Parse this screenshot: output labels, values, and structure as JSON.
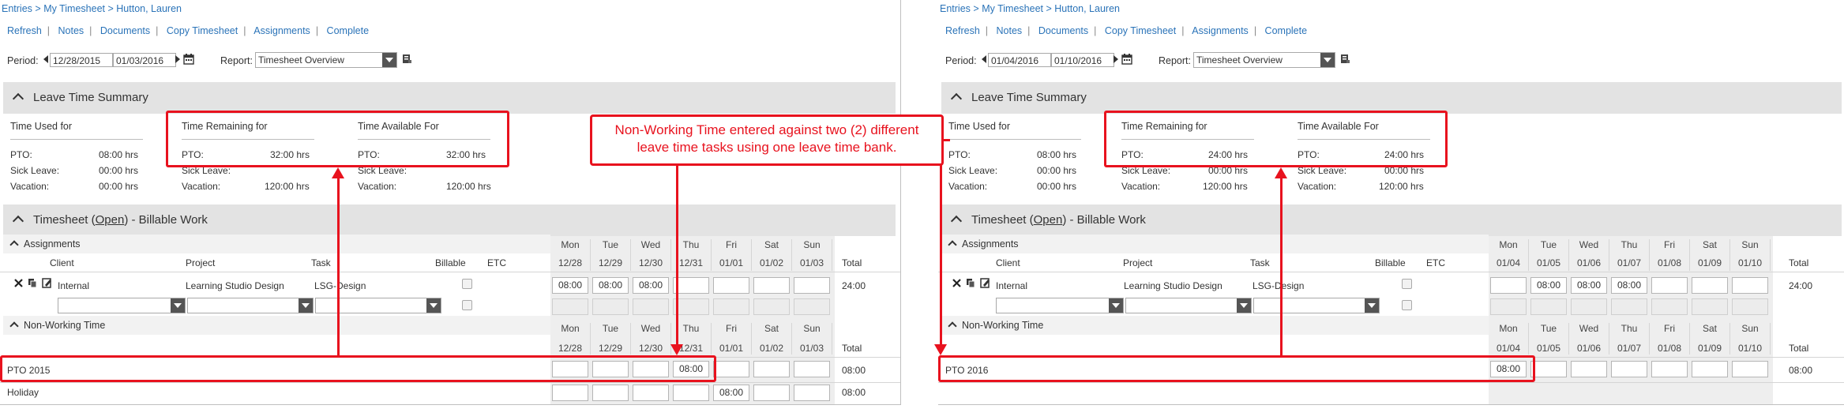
{
  "colors": {
    "link": "#2a73b8",
    "annotation_red": "#e8121e",
    "section_bg": "#e3e3e3"
  },
  "icons": [
    "prev-arrow-icon",
    "next-arrow-icon",
    "calendar-icon",
    "export-icon",
    "delete-icon",
    "copy-icon",
    "edit-icon",
    "collapse-caret-icon"
  ],
  "callout": {
    "line1": "Non-Working Time entered against two (2) different",
    "line2": "leave time tasks using one leave time bank."
  },
  "panels": {
    "left": {
      "breadcrumb": {
        "entries": "Entries",
        "sep1": ">",
        "my_timesheet": "My Timesheet",
        "sep2": ">",
        "user": "Hutton, Lauren"
      },
      "toolbar": [
        "Refresh",
        "Notes",
        "Documents",
        "Copy Timesheet",
        "Assignments",
        "Complete"
      ],
      "toolbar_sep": "|",
      "period_label": "Period:",
      "period_start": "12/28/2015",
      "period_end": "01/03/2016",
      "report_label": "Report:",
      "report_value": "Timesheet Overview",
      "leave_summary": {
        "title": "Leave Time Summary",
        "used_header": "Time Used for",
        "remaining_header": "Time Remaining for",
        "available_header": "Time Available For",
        "labels": [
          "PTO:",
          "Sick Leave:",
          "Vacation:"
        ],
        "used": [
          "08:00 hrs",
          "00:00 hrs",
          "00:00 hrs"
        ],
        "remaining": [
          "32:00 hrs",
          "",
          ""
        ],
        "available": [
          "32:00 hrs",
          "",
          "120:00 hrs"
        ],
        "remaining_partial": [
          "",
          "Sick Leave:",
          "Vacation:"
        ],
        "remaining_vals_hidden": [
          "",
          "",
          "120:00 hrs"
        ],
        "available_labels": [
          "PTO:",
          "Sick Leave:",
          "Vacation:"
        ]
      },
      "timesheet": {
        "title_prefix": "Timesheet (",
        "status": "Open",
        "title_suffix": ")  - Billable Work",
        "assignments_label": "Assignments",
        "columns": [
          "Client",
          "Project",
          "Task",
          "Billable",
          "ETC"
        ],
        "days": [
          "Mon",
          "Tue",
          "Wed",
          "Thu",
          "Fri",
          "Sat",
          "Sun"
        ],
        "dates": [
          "12/28",
          "12/29",
          "12/30",
          "12/31",
          "01/01",
          "01/02",
          "01/03"
        ],
        "total_label": "Total",
        "assignment_row": {
          "client": "Internal",
          "project": "Learning Studio Design",
          "task": "LSG-Design",
          "hours": [
            "08:00",
            "08:00",
            "08:00",
            "",
            "",
            "",
            ""
          ],
          "total": "24:00"
        },
        "nonworking_label": "Non-Working Time",
        "nonworking_rows": [
          {
            "name": "PTO 2015",
            "hours": [
              "",
              "",
              "",
              "08:00",
              "",
              "",
              ""
            ],
            "total": "08:00"
          },
          {
            "name": "Holiday",
            "hours": [
              "",
              "",
              "",
              "",
              "08:00",
              "",
              ""
            ],
            "total": "08:00"
          }
        ]
      }
    },
    "right": {
      "breadcrumb": {
        "entries": "Entries",
        "sep1": ">",
        "my_timesheet": "My Timesheet",
        "sep2": ">",
        "user": "Hutton, Lauren"
      },
      "toolbar": [
        "Refresh",
        "Notes",
        "Documents",
        "Copy Timesheet",
        "Assignments",
        "Complete"
      ],
      "toolbar_sep": "|",
      "period_label": "Period:",
      "period_start": "01/04/2016",
      "period_end": "01/10/2016",
      "report_label": "Report:",
      "report_value": "Timesheet Overview",
      "leave_summary": {
        "title": "Leave Time Summary",
        "used_header": "Time Used for",
        "remaining_header": "Time Remaining for",
        "available_header": "Time Available For",
        "labels": [
          "PTO:",
          "Sick Leave:",
          "Vacation:"
        ],
        "used": [
          "08:00 hrs",
          "00:00 hrs",
          "00:00 hrs"
        ],
        "remaining": [
          "24:00 hrs",
          "00:00 hrs",
          "120:00 hrs"
        ],
        "available": [
          "24:00 hrs",
          "00:00 hrs",
          "120:00 hrs"
        ]
      },
      "timesheet": {
        "title_prefix": "Timesheet (",
        "status": "Open",
        "title_suffix": ")  - Billable Work",
        "assignments_label": "Assignments",
        "columns": [
          "Client",
          "Project",
          "Task",
          "Billable",
          "ETC"
        ],
        "days": [
          "Mon",
          "Tue",
          "Wed",
          "Thu",
          "Fri",
          "Sat",
          "Sun"
        ],
        "dates": [
          "01/04",
          "01/05",
          "01/06",
          "01/07",
          "01/08",
          "01/09",
          "01/10"
        ],
        "total_label": "Total",
        "assignment_row": {
          "client": "Internal",
          "project": "Learning Studio Design",
          "task": "LSG-Design",
          "hours": [
            "",
            "08:00",
            "08:00",
            "08:00",
            "",
            "",
            ""
          ],
          "total": "24:00"
        },
        "nonworking_label": "Non-Working Time",
        "nonworking_rows": [
          {
            "name": "PTO 2016",
            "hours": [
              "08:00",
              "",
              "",
              "",
              "",
              "",
              ""
            ],
            "total": "08:00"
          }
        ]
      }
    }
  }
}
